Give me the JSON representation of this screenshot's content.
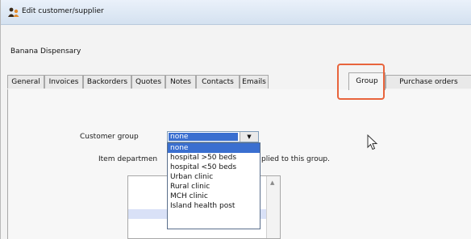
{
  "window": {
    "title": "Edit customer/supplier"
  },
  "customer": {
    "name": "Banana Dispensary"
  },
  "tabs": [
    {
      "label": "General"
    },
    {
      "label": "Invoices"
    },
    {
      "label": "Backorders"
    },
    {
      "label": "Quotes"
    },
    {
      "label": "Notes"
    },
    {
      "label": "Contacts"
    },
    {
      "label": "Emails"
    },
    {
      "label": "Group"
    },
    {
      "label": "Purchase orders"
    }
  ],
  "active_tab": "Group",
  "group_tab": {
    "customer_group_label": "Customer group",
    "customer_group_value": "none",
    "item_dept_label_start": "Item departmen",
    "item_dept_label_end": "plied to this group.",
    "options": [
      "none",
      "hospital >50 beds",
      "hospital <50 beds",
      "Urban clinic",
      "Rural clinic",
      "MCH clinic",
      "Island health post"
    ]
  },
  "colors": {
    "highlight_outline": "#e8643c",
    "selection": "#3a6fd0"
  },
  "icons": {
    "title": "customer-supplier-icon",
    "combo_arrow": "chevron-down-icon",
    "cursor": "mouse-pointer-icon"
  }
}
